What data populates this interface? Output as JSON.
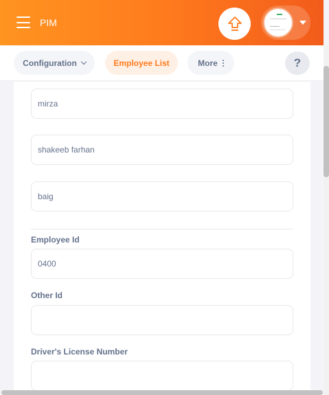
{
  "header": {
    "module_title": "PIM"
  },
  "nav": {
    "configuration": "Configuration",
    "employee_list": "Employee List",
    "more": "More",
    "help": "?"
  },
  "form": {
    "last_name_value": "mirza",
    "first_name_value": "shakeeb farhan",
    "middle_name_value": "baig",
    "employee_id_label": "Employee Id",
    "employee_id_value": "0400",
    "other_id_label": "Other Id",
    "other_id_value": "",
    "drivers_license_label": "Driver's License Number",
    "drivers_license_value": ""
  },
  "colors": {
    "brand_orange": "#ff7b1d",
    "active_tab_bg": "#fff0e5",
    "text_muted": "#64728c"
  }
}
